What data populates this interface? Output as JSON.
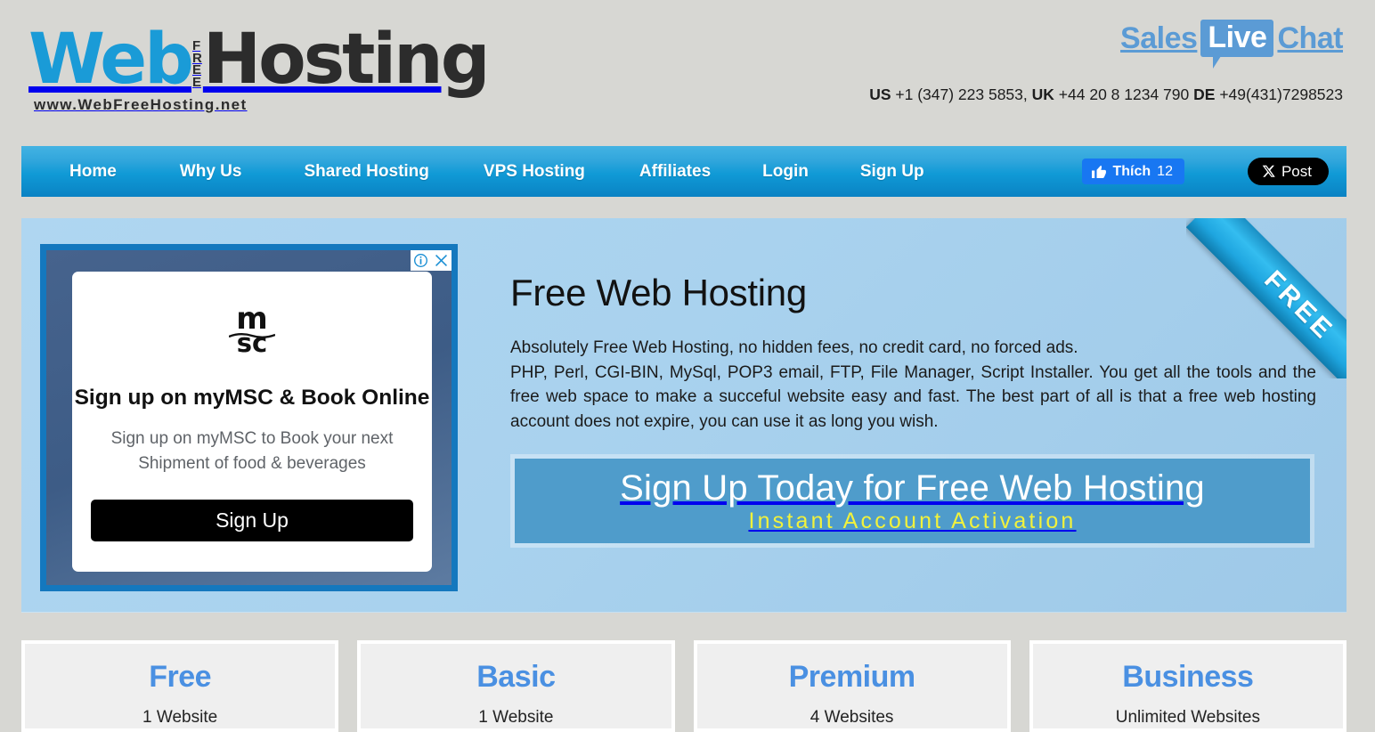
{
  "header": {
    "logo": {
      "web": "Web",
      "free_top": "F",
      "free_stack": [
        "F",
        "R",
        "E",
        "E"
      ],
      "hosting": "Hosting",
      "url": "www.WebFreeHosting.net"
    },
    "live_chat": {
      "sales": "Sales",
      "live": "Live",
      "chat": "Chat"
    },
    "phones": {
      "us_label": "US",
      "us_number": "+1 (347) 223 5853,",
      "uk_label": "UK",
      "uk_number": "+44 20 8 1234 790",
      "de_label": "DE",
      "de_number": "+49(431)7298523"
    }
  },
  "nav": {
    "items": [
      {
        "label": "Home"
      },
      {
        "label": "Why Us"
      },
      {
        "label": "Shared Hosting"
      },
      {
        "label": "VPS Hosting"
      },
      {
        "label": "Affiliates"
      },
      {
        "label": "Login"
      },
      {
        "label": "Sign Up"
      }
    ],
    "facebook": {
      "label": "Thích",
      "count": "12"
    },
    "twitter": {
      "label": "Post"
    },
    "colors": {
      "top": "#44b3e3",
      "bottom": "#0a82c3"
    }
  },
  "hero": {
    "ribbon": "FREE",
    "title": "Free Web Hosting",
    "paragraph_line1": "Absolutely Free Web Hosting, no hidden fees, no credit card, no forced ads.",
    "paragraph_body": "PHP, Perl, CGI-BIN, MySql, POP3 email, FTP, File Manager, Script Installer. You get all the tools and the free web space to make a succeful website easy and fast. The best part of all is that a free web hosting account does not expire, you can use it as long you wish.",
    "banner": {
      "line1": "Sign Up Today for Free Web Hosting",
      "line2": "Instant Account Activation"
    },
    "colors": {
      "background": "#aed4ee",
      "banner": "#4f9ccb",
      "banner_accent": "#f2f23b"
    }
  },
  "ad": {
    "brand": {
      "top": "m",
      "bottom": "sc"
    },
    "title": "Sign up on myMSC & Book Online",
    "body_line1": "Sign up on myMSC to Book your next",
    "body_line2": "Shipment of food & beverages",
    "button": "Sign Up",
    "adchoices_icon": "info-circle-icon",
    "close_icon": "close-icon"
  },
  "plans": [
    {
      "name": "Free",
      "sites": "1 Website"
    },
    {
      "name": "Basic",
      "sites": "1 Website"
    },
    {
      "name": "Premium",
      "sites": "4 Websites"
    },
    {
      "name": "Business",
      "sites": "Unlimited Websites"
    }
  ]
}
